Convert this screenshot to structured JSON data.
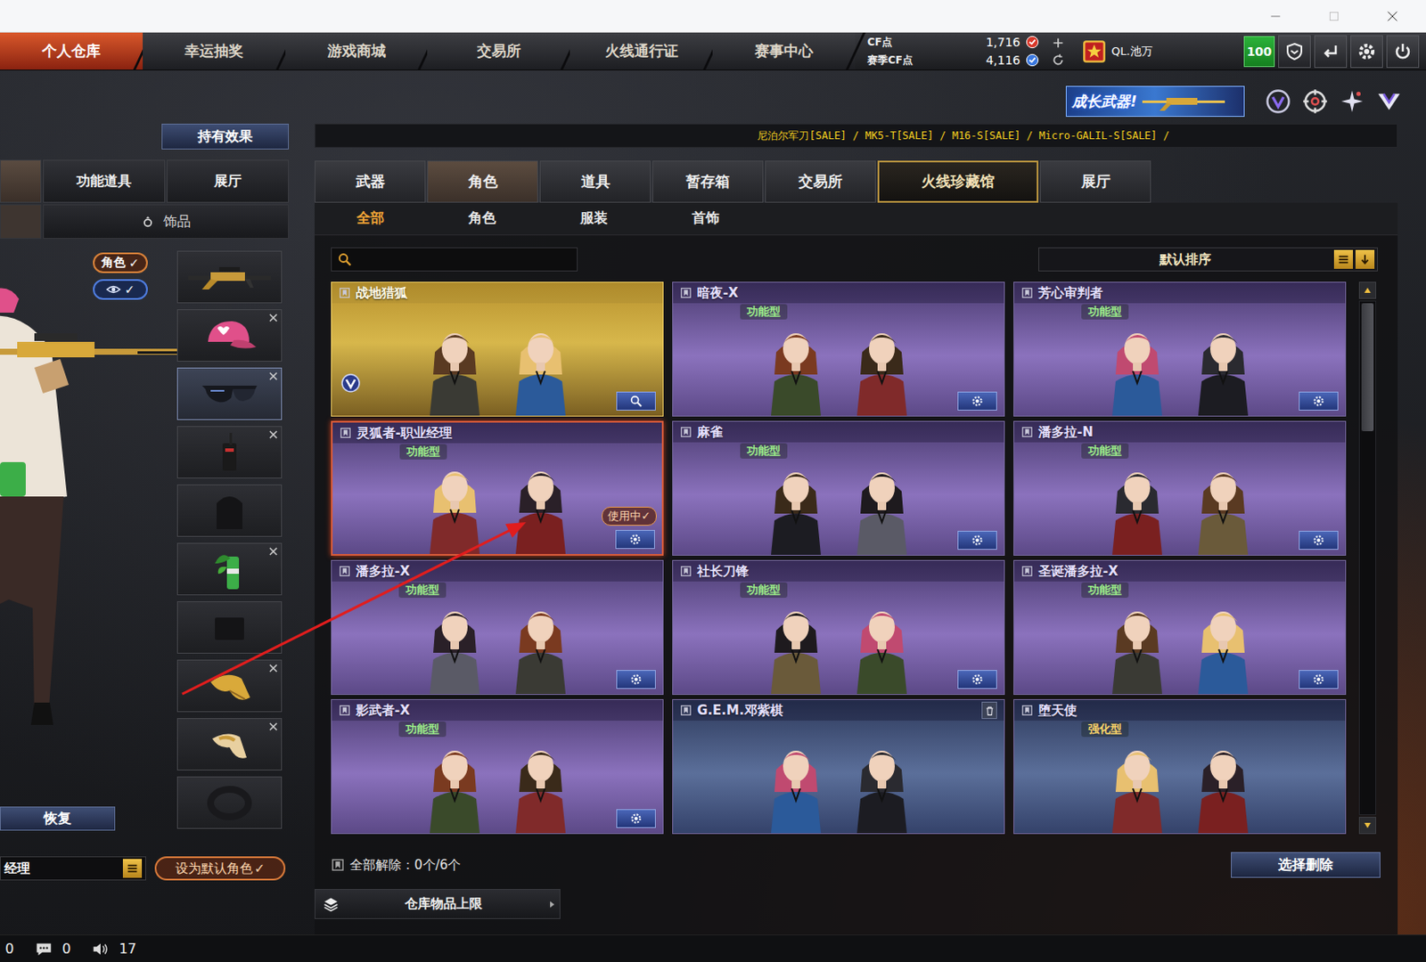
{
  "nav": {
    "tabs": [
      {
        "label": "个人仓库",
        "selected": true
      },
      {
        "label": "幸运抽奖",
        "selected": false
      },
      {
        "label": "游戏商城",
        "selected": false
      },
      {
        "label": "交易所",
        "selected": false
      },
      {
        "label": "火线通行证",
        "selected": false
      },
      {
        "label": "赛事中心",
        "selected": false
      }
    ],
    "currencies": [
      {
        "label": "CF点",
        "value": "1,716",
        "color": "#d8382a"
      },
      {
        "label": "赛季CF点",
        "value": "4,116",
        "color": "#3a78e0"
      }
    ],
    "user": {
      "name": "QL.池万",
      "level": "100"
    }
  },
  "banner": {
    "title": "成长武器!"
  },
  "left": {
    "hold_effect": "持有效果",
    "tabs": [
      {
        "label": "",
        "selected": true
      },
      {
        "label": "功能道具",
        "selected": false
      },
      {
        "label": "展厅",
        "selected": false
      }
    ],
    "subtabs": [
      {
        "label": "",
        "selected": true
      },
      {
        "label": "饰品",
        "selected": false
      }
    ],
    "toggles": [
      {
        "kind": "text",
        "label": "角色",
        "check": "✓",
        "on": true
      },
      {
        "kind": "eye",
        "label": "",
        "check": "✓",
        "on": true
      }
    ],
    "slots": [
      {
        "kind": "rifle",
        "removable": false,
        "selected": false
      },
      {
        "kind": "hat",
        "removable": true,
        "selected": false
      },
      {
        "kind": "glasses",
        "removable": true,
        "selected": true
      },
      {
        "kind": "radio",
        "removable": true,
        "selected": false
      },
      {
        "kind": "bag",
        "removable": false,
        "selected": false
      },
      {
        "kind": "bottle",
        "removable": true,
        "selected": false
      },
      {
        "kind": "cloth",
        "removable": false,
        "selected": false
      },
      {
        "kind": "gold",
        "removable": true,
        "selected": false
      },
      {
        "kind": "gold2",
        "removable": true,
        "selected": false
      },
      {
        "kind": "ring",
        "removable": false,
        "selected": false
      }
    ],
    "restore": "恢复",
    "name_field": "经理",
    "default_button": "设为默认角色",
    "default_check": "✓"
  },
  "ticker": "尼泊尔军刀[SALE] / MK5-T[SALE] / M16-S[SALE] / Micro-GALIL-S[SALE] /",
  "tabs": [
    {
      "label": "武器",
      "selected": false,
      "featured": false
    },
    {
      "label": "角色",
      "selected": true,
      "featured": false
    },
    {
      "label": "道具",
      "selected": false,
      "featured": false
    },
    {
      "label": "暂存箱",
      "selected": false,
      "featured": false
    },
    {
      "label": "交易所",
      "selected": false,
      "featured": false
    },
    {
      "label": "火线珍藏馆",
      "selected": false,
      "featured": true
    },
    {
      "label": "展厅",
      "selected": false,
      "featured": false
    }
  ],
  "subtabs": [
    {
      "label": "全部",
      "selected": true
    },
    {
      "label": "角色",
      "selected": false
    },
    {
      "label": "服装",
      "selected": false
    },
    {
      "label": "首饰",
      "selected": false
    }
  ],
  "search": {
    "value": ""
  },
  "sort": {
    "label": "默认排序"
  },
  "cards": [
    {
      "name": "战地猎狐",
      "badge": "",
      "kind": "gold",
      "action": "search",
      "selected": false,
      "in_use": false,
      "in_use_label": "",
      "vip": true
    },
    {
      "name": "暗夜-X",
      "badge": "功能型",
      "kind": "purple",
      "action": "settings",
      "selected": false,
      "in_use": false,
      "in_use_label": "",
      "vip": false
    },
    {
      "name": "芳心审判者",
      "badge": "功能型",
      "kind": "purple",
      "action": "settings",
      "selected": false,
      "in_use": false,
      "in_use_label": "",
      "vip": false
    },
    {
      "name": "灵狐者-职业经理",
      "badge": "功能型",
      "kind": "purple",
      "action": "settings",
      "selected": true,
      "in_use": true,
      "in_use_label": "使用中✓",
      "vip": false
    },
    {
      "name": "麻雀",
      "badge": "功能型",
      "kind": "purple",
      "action": "settings",
      "selected": false,
      "in_use": false,
      "in_use_label": "",
      "vip": false
    },
    {
      "name": "潘多拉-N",
      "badge": "功能型",
      "kind": "purple",
      "action": "settings",
      "selected": false,
      "in_use": false,
      "in_use_label": "",
      "vip": false
    },
    {
      "name": "潘多拉-X",
      "badge": "功能型",
      "kind": "purple",
      "action": "settings",
      "selected": false,
      "in_use": false,
      "in_use_label": "",
      "vip": false
    },
    {
      "name": "社长刀锋",
      "badge": "功能型",
      "kind": "purple",
      "action": "settings",
      "selected": false,
      "in_use": false,
      "in_use_label": "",
      "vip": false
    },
    {
      "name": "圣诞潘多拉-X",
      "badge": "功能型",
      "kind": "purple",
      "action": "settings",
      "selected": false,
      "in_use": false,
      "in_use_label": "",
      "vip": false
    },
    {
      "name": "影武者-X",
      "badge": "功能型",
      "kind": "purple",
      "action": "settings",
      "selected": false,
      "in_use": false,
      "in_use_label": "",
      "vip": false
    },
    {
      "name": "G.E.M.邓紫棋",
      "badge": "",
      "kind": "blue",
      "action": "delete",
      "selected": false,
      "in_use": false,
      "in_use_label": "",
      "vip": false
    },
    {
      "name": "堕天使",
      "badge": "强化型",
      "kind": "blue",
      "action": "none",
      "selected": false,
      "in_use": false,
      "in_use_label": "",
      "vip": false
    }
  ],
  "scrollbar": {
    "level": 0.25
  },
  "footer": {
    "release_all": "全部解除：0个/6个",
    "delete_button": "选择删除",
    "capacity": "仓库物品上限"
  },
  "status_bar": [
    {
      "kind": "count",
      "value": "0"
    },
    {
      "kind": "chat",
      "value": "0"
    },
    {
      "kind": "volume",
      "value": "17"
    }
  ]
}
